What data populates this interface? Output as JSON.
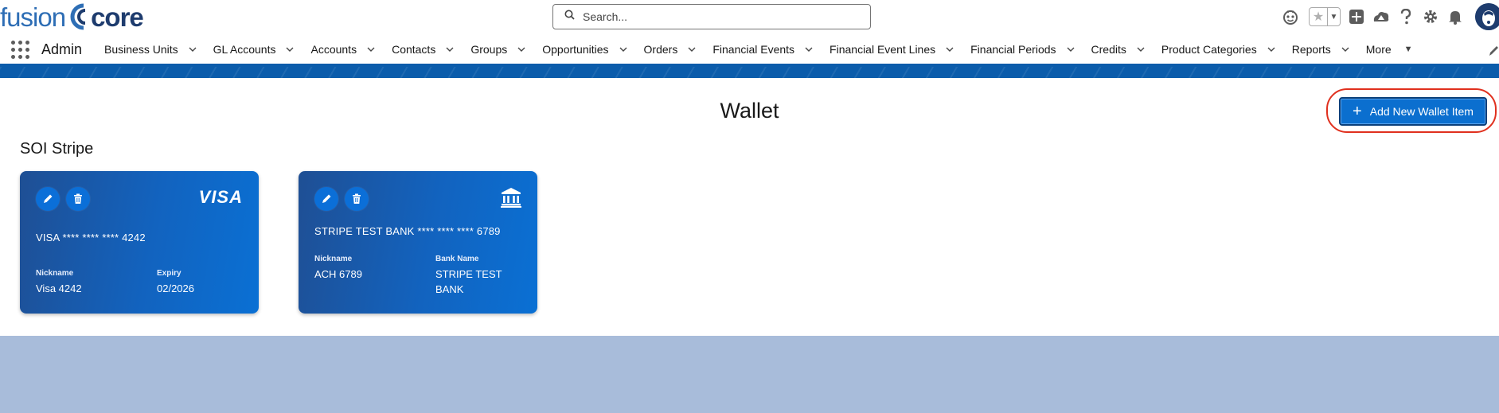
{
  "header": {
    "logo": {
      "left": "fusion",
      "right": "core"
    },
    "search": {
      "placeholder": "Search...",
      "value": ""
    },
    "icons": [
      "assistant-icon",
      "favorite-star-icon",
      "add-icon",
      "trailhead-icon",
      "help-icon",
      "settings-icon",
      "notifications-bell-icon",
      "user-avatar"
    ]
  },
  "nav": {
    "app_name": "Admin",
    "items": [
      {
        "label": "Business Units"
      },
      {
        "label": "GL Accounts"
      },
      {
        "label": "Accounts"
      },
      {
        "label": "Contacts"
      },
      {
        "label": "Groups"
      },
      {
        "label": "Opportunities"
      },
      {
        "label": "Orders"
      },
      {
        "label": "Financial Events"
      },
      {
        "label": "Financial Event Lines"
      },
      {
        "label": "Financial Periods"
      },
      {
        "label": "Credits"
      },
      {
        "label": "Product Categories"
      },
      {
        "label": "Reports"
      }
    ],
    "more_label": "More"
  },
  "page": {
    "title": "Wallet",
    "add_button_label": "Add New Wallet Item",
    "section_title": "SOI Stripe"
  },
  "wallet_items": [
    {
      "brand": "VISA",
      "brand_icon": "visa-logo",
      "number": "VISA **** **** **** 4242",
      "field1_label": "Nickname",
      "field1_value": "Visa 4242",
      "field2_label": "Expiry",
      "field2_value": "02/2026"
    },
    {
      "brand": "",
      "brand_icon": "bank-icon",
      "number": "STRIPE TEST BANK **** **** **** 6789",
      "field1_label": "Nickname",
      "field1_value": "ACH 6789",
      "field2_label": "Bank Name",
      "field2_value": "STRIPE TEST BANK"
    }
  ],
  "colors": {
    "brand_blue": "#0b5cab",
    "button_blue": "#0b6fcf",
    "card_gradient_start": "#1f4f94",
    "card_gradient_end": "#0a70d4",
    "highlight_ring": "#e0301e",
    "backdrop": "#a8bcda"
  }
}
